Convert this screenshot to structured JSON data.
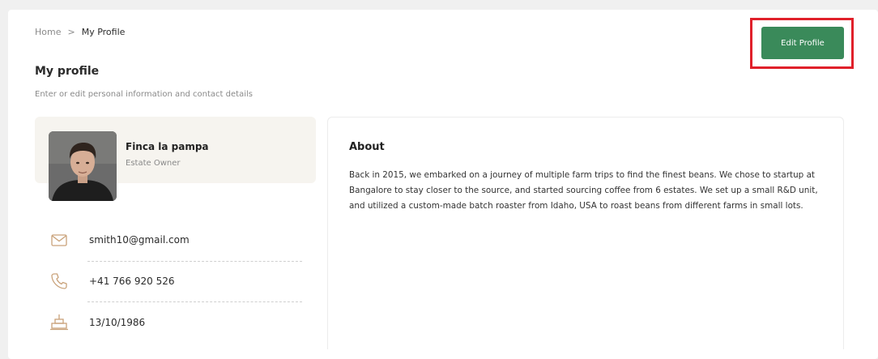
{
  "breadcrumb": {
    "home": "Home",
    "separator": ">",
    "current": "My Profile"
  },
  "header": {
    "title": "My profile",
    "subtitle": "Enter or edit personal information and contact details",
    "edit_button": "Edit Profile"
  },
  "profile": {
    "name": "Finca la pampa",
    "role": "Estate Owner",
    "avatar": "user-photo"
  },
  "contacts": [
    {
      "icon": "mail-icon",
      "value": "smith10@gmail.com"
    },
    {
      "icon": "phone-icon",
      "value": "+41  766 920 526"
    },
    {
      "icon": "birthday-cake-icon",
      "value": "13/10/1986"
    }
  ],
  "about": {
    "title": "About",
    "text": "Back in 2015, we embarked on a journey of multiple farm trips to find the finest beans. We chose to startup at Bangalore to stay closer to the source, and started sourcing coffee from 6 estates. We set up a small R&D unit, and utilized a custom-made batch roaster from Idaho, USA to roast beans from different farms in small lots."
  },
  "colors": {
    "accent": "#3a8a5a",
    "highlight": "#e0202a",
    "icon": "#c9a27a",
    "card_bg": "#f6f4ef"
  }
}
